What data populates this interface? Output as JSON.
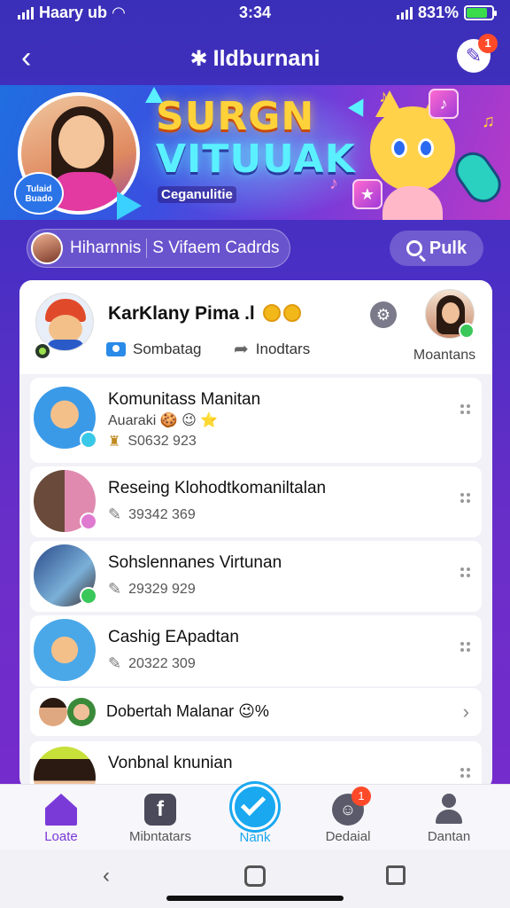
{
  "status_bar": {
    "carrier": "Haary ub",
    "time": "3:34",
    "battery": "831%",
    "battery_level": 0.83
  },
  "header": {
    "title": "Ildburnani",
    "action_badge": "1"
  },
  "banner": {
    "title_line1": "SURGN",
    "title_line2": "VITUUAK",
    "subtitle": "Ceganulitie",
    "stamp_text": "Tulaid Buado"
  },
  "filter": {
    "segment1": "Hiharnnis",
    "segment2": "S Vifaem Cadrds",
    "search_label": "Pulk"
  },
  "profile": {
    "name": "KarKlany Pima .l",
    "action1": "Sombatag",
    "action2": "Inodtars",
    "right_label": "Moantans"
  },
  "list": [
    {
      "title": "Komunitass Manitan",
      "sub": "Auaraki 🍪 😉 ⭐",
      "meta": "S0632 923"
    },
    {
      "title": "Reseing Klohodtkomaniltalan",
      "meta": "39342 369"
    },
    {
      "title": "Sohslennanes Virtunan",
      "meta": "29329 929"
    },
    {
      "title": "Cashig EApadtan",
      "meta": "20322 309"
    }
  ],
  "mini_row": {
    "title": "Dobertah Malanar 😉%"
  },
  "last_item": {
    "title": "Vonbnal knunian"
  },
  "bottom_nav": {
    "home": "Loate",
    "feed": "Mibntatars",
    "center": "Nank",
    "chat": "Dedaial",
    "chat_badge": "1",
    "profile": "Dantan"
  },
  "colors": {
    "accent": "#7a3ad8",
    "center_button": "#1aa8f0",
    "badge": "#ff4a2a"
  }
}
